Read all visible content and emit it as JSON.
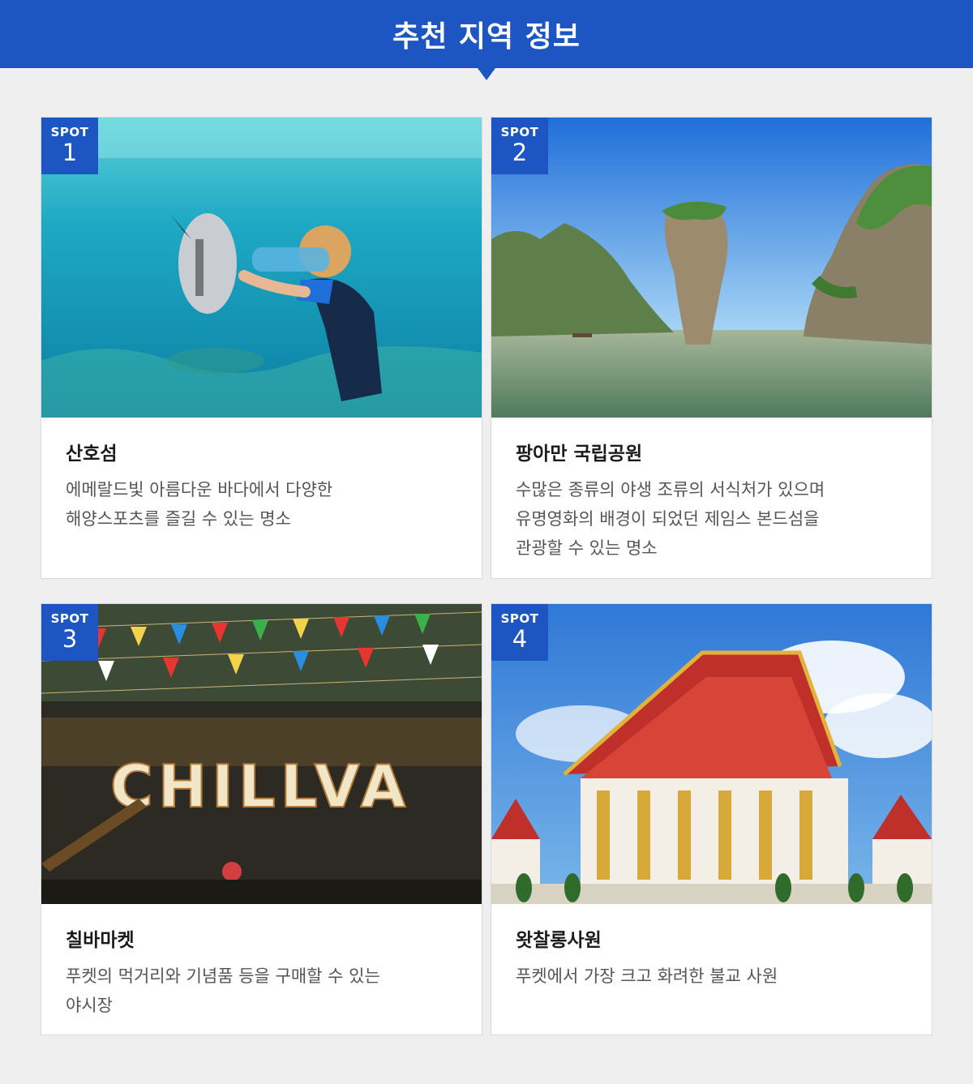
{
  "header": {
    "title": "추천 지역 정보"
  },
  "spots": [
    {
      "badge_label": "SPOT",
      "number": "1",
      "title": "산호섬",
      "description_lines": [
        "에메랄드빛 아름다운 바다에서 다양한",
        "해양스포츠를 즐길 수 있는 명소"
      ]
    },
    {
      "badge_label": "SPOT",
      "number": "2",
      "title": "팡아만 국립공원",
      "description_lines": [
        "수많은 종류의 야생 조류의 서식처가 있으며",
        "유명영화의 배경이 되었던 제임스 본드섬을",
        "관광할 수 있는 명소"
      ]
    },
    {
      "badge_label": "SPOT",
      "number": "3",
      "title": "칠바마켓",
      "description_lines": [
        "푸켓의 먹거리와 기념품 등을 구매할 수 있는",
        "야시장"
      ],
      "photo_sign_text": "CHILLVA"
    },
    {
      "badge_label": "SPOT",
      "number": "4",
      "title": "왓찰롱사원",
      "description_lines": [
        "푸켓에서 가장 크고 화려한 불교 사원"
      ]
    }
  ],
  "colors": {
    "brand_blue": "#1d55c2",
    "background": "#efefef"
  }
}
